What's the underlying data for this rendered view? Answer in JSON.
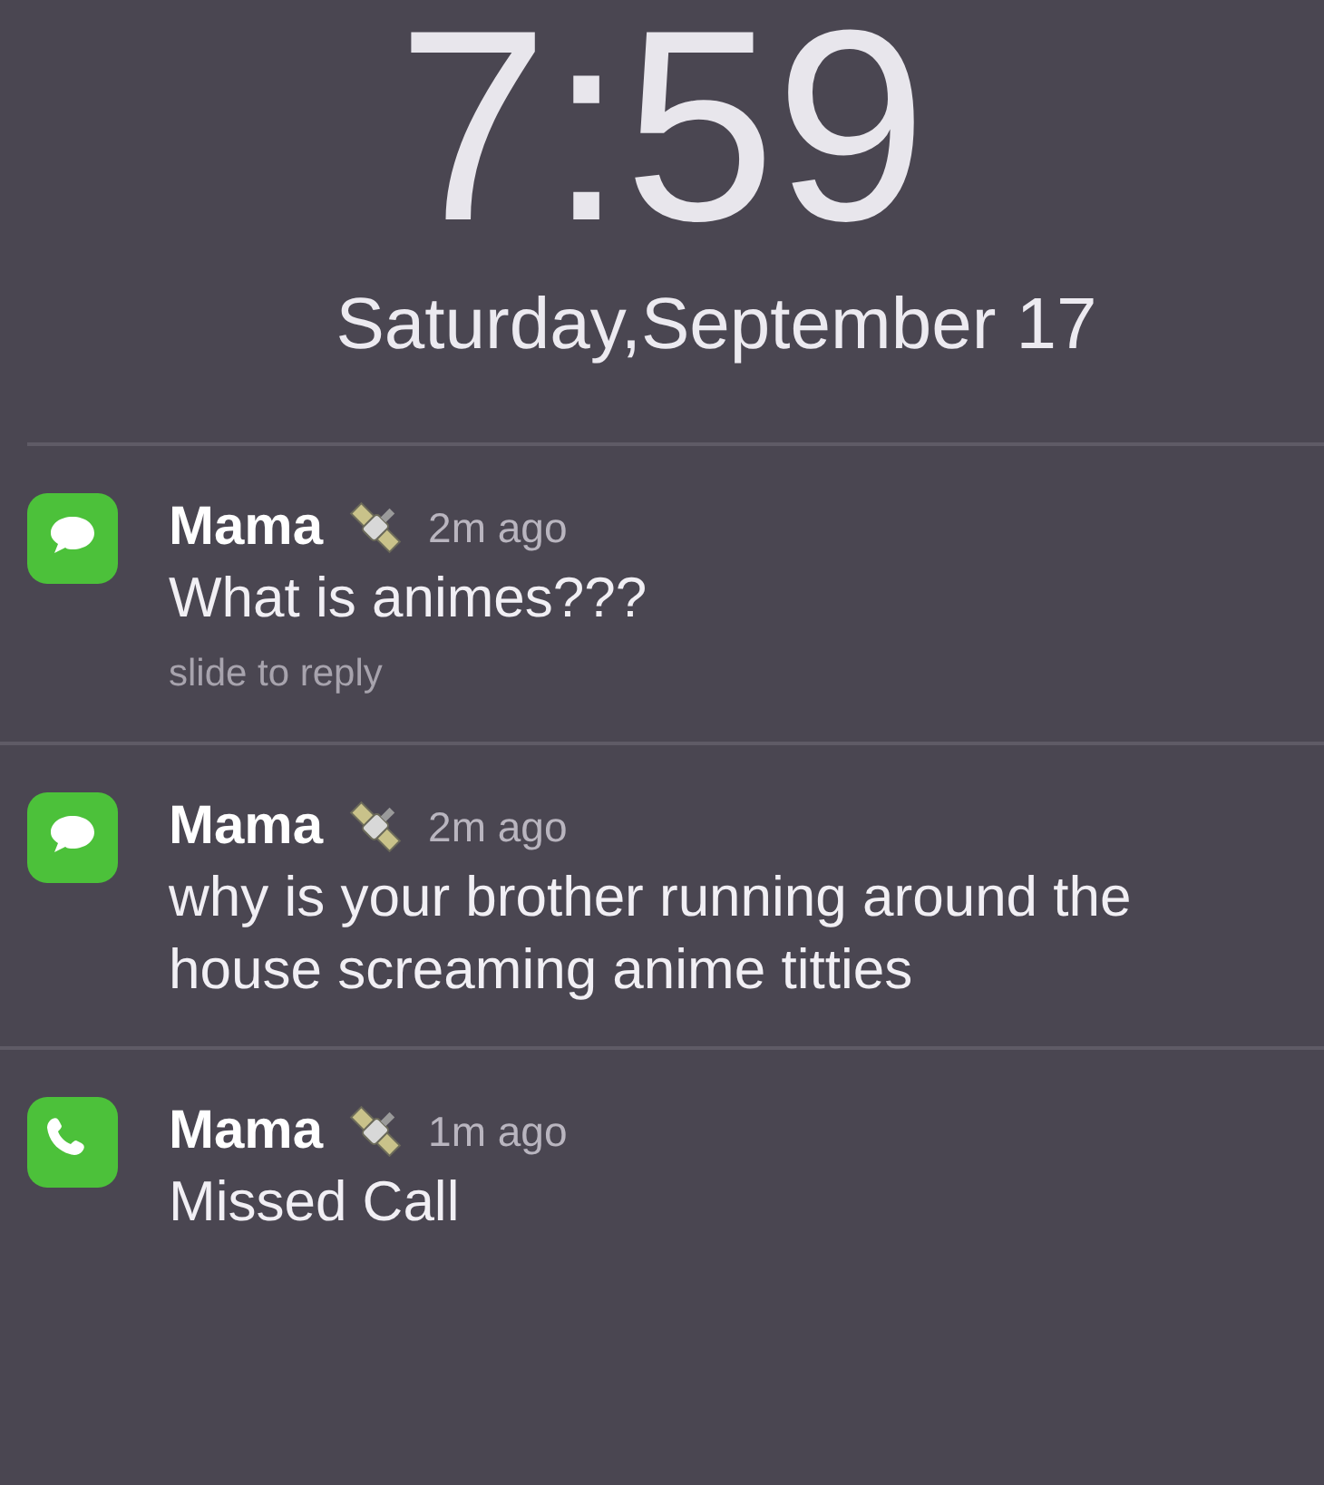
{
  "clock": {
    "time": "7:59",
    "date": "Saturday,September 17"
  },
  "notifications": [
    {
      "kind": "message",
      "sender": "Mama",
      "time": "2m ago",
      "text": "What is animes???",
      "hint": "slide to reply"
    },
    {
      "kind": "message",
      "sender": "Mama",
      "time": "2m ago",
      "text": "why is your brother running around the house screaming anime titties"
    },
    {
      "kind": "call",
      "sender": "Mama",
      "time": "1m ago",
      "text": "Missed Call"
    }
  ]
}
